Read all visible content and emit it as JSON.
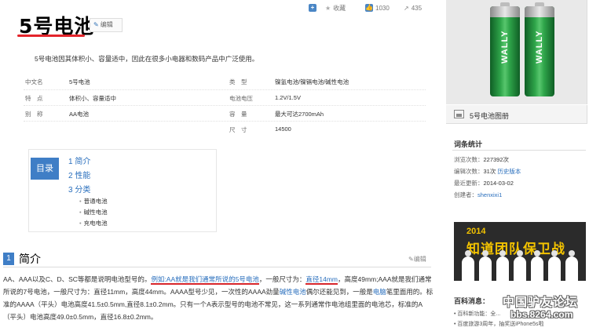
{
  "title": "5号电池",
  "edit_label": "编辑",
  "toolbar": {
    "collect": "收藏",
    "like_count": "1030",
    "share_count": "435"
  },
  "summary": "5号电池因其体积小、容量适中，因此在很多小电器和数码产品中广泛使用。",
  "info": [
    {
      "k1": "中文名",
      "v1": "5号电池",
      "k2": "类　型",
      "v2": "镍氢电池/镍镉电池/碱性电池"
    },
    {
      "k1": "特　点",
      "v1": "体积小、容量适中",
      "k2": "电池电压",
      "v2": "1.2V/1.5V"
    },
    {
      "k1": "别　称",
      "v1": "AA电池",
      "k2": "容　量",
      "v2": "最大可达2700mAh"
    },
    {
      "k1": "",
      "v1": "",
      "k2": "尺　寸",
      "v2": "14500"
    }
  ],
  "toc": {
    "badge": "目录",
    "items": [
      "1 简介",
      "2 性能",
      "3 分类"
    ],
    "subs": [
      "普通电池",
      "碱性电池",
      "充电电池"
    ]
  },
  "section": {
    "number": "1",
    "title": "简介",
    "edit": "编辑",
    "p1": "AA、AAA以及C、D、SC等都是说明电池型号的。",
    "p2": "例如:AA就是我们通常所说的5号电池",
    "p3": "，一般尺寸为：",
    "p4": "直径14mm",
    "p5": "，高度49mm;AAA就是我们通常所说的7号电池，一般尺寸为：直径11mm，高度44mm。AAAA型号少见，一次性的AAAA劲量",
    "p6": "碱性电池",
    "p7": "偶尔还能见到，一般是",
    "p8": "电脑",
    "p9": "笔里面用的。标准的AAAA（平头）电池高度41.5±0.5mm,直径8.1±0.2mm。只有一个A表示型号的电池不常见，这一系列通常作电池组里面的电池芯，标准的A（平头）电池高度49.0±0.5mm，直径16.8±0.2mm。"
  },
  "sidebar": {
    "battery_brand": "WALLY",
    "album": "5号电池图册",
    "stats_title": "词条统计",
    "stats": [
      {
        "label": "浏览次数：",
        "value": "227392次"
      },
      {
        "label": "编辑次数：",
        "value": "31次",
        "link": "历史版本"
      },
      {
        "label": "最近更新：",
        "value": "2014-03-02"
      },
      {
        "label": "创建者：",
        "value": "shenxixi1"
      }
    ],
    "banner_year": "2014",
    "banner_text": "知道团队保卫战",
    "news_title": "百科消息：",
    "news": [
      "百科新功能：全...",
      "百度旅游3周年，抽奖送iPhone5s啦"
    ]
  },
  "watermark": {
    "line1": "中国驴友论坛",
    "line2": "bbs.8264.com"
  }
}
